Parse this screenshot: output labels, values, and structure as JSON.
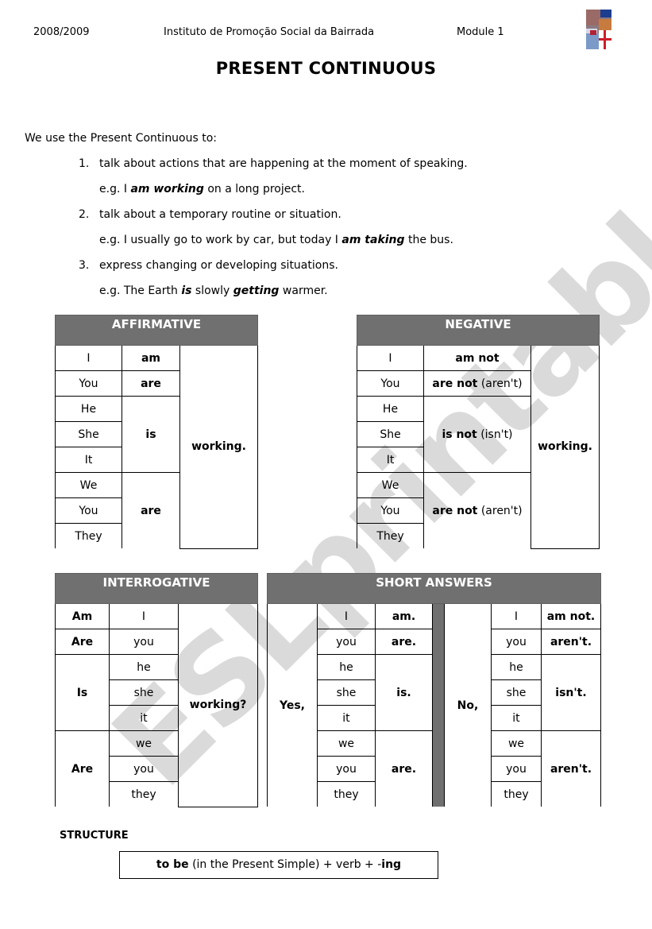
{
  "header": {
    "year": "2008/2009",
    "institution": "Instituto de Promoção Social da Bairrada",
    "module": "Module 1",
    "logo_icon": "flags-collage-image"
  },
  "title": "PRESENT CONTINUOUS",
  "intro": "We use the Present Continuous to:",
  "uses": [
    {
      "num": "1.",
      "text": "talk about actions that are happening at the moment of speaking.",
      "example": {
        "pre": "e.g. I ",
        "bold1": "am working",
        "mid": " on a long project.",
        "bold2": "",
        "post": ""
      }
    },
    {
      "num": "2.",
      "text": "talk about a temporary routine or situation.",
      "example": {
        "pre": "e.g. I usually go to work by car, but today I ",
        "bold1": "am taking",
        "mid": " the bus.",
        "bold2": "",
        "post": ""
      }
    },
    {
      "num": "3.",
      "text": "express changing or developing situations.",
      "example": {
        "pre": "e.g. The Earth ",
        "bold1": "is",
        "mid": " slowly ",
        "bold2": "getting",
        "post": " warmer."
      }
    }
  ],
  "affirmative": {
    "title": "AFFIRMATIVE",
    "subjects": [
      "I",
      "You",
      "He",
      "She",
      "It",
      "We",
      "You",
      "They"
    ],
    "verbs": {
      "i": "am",
      "you": "are",
      "third": "is",
      "plural": "are"
    },
    "ending": "working."
  },
  "negative": {
    "title": "NEGATIVE",
    "subjects": [
      "I",
      "You",
      "He",
      "She",
      "It",
      "We",
      "You",
      "They"
    ],
    "verbs": {
      "i": {
        "bold": "am not",
        "contraction": ""
      },
      "you": {
        "bold": "are not",
        "contraction": " (aren't)"
      },
      "third": {
        "bold": "is not",
        "contraction": " (isn't)"
      },
      "plural": {
        "bold": "are not",
        "contraction": " (aren't)"
      }
    },
    "ending": "working."
  },
  "interrogative": {
    "title": "INTERROGATIVE",
    "verbs": {
      "i": "Am",
      "you": "Are",
      "third": "Is",
      "plural": "Are"
    },
    "subjects": [
      "I",
      "you",
      "he",
      "she",
      "it",
      "we",
      "you",
      "they"
    ],
    "ending": "working?"
  },
  "short_answers": {
    "title": "SHORT ANSWERS",
    "yes": "Yes,",
    "no": "No,",
    "subjects": [
      "I",
      "you",
      "he",
      "she",
      "it",
      "we",
      "you",
      "they"
    ],
    "yes_verbs": {
      "i": "am.",
      "you": "are.",
      "third": "is.",
      "plural": "are."
    },
    "no_verbs": {
      "i": "am not.",
      "you": "aren't.",
      "third": "isn't.",
      "plural": "aren't."
    }
  },
  "structure": {
    "label": "STRUCTURE",
    "bold1": "to be",
    "mid": " (in the Present Simple) + verb + -",
    "bold2": "ing"
  },
  "watermark": "ESLprintables.com"
}
